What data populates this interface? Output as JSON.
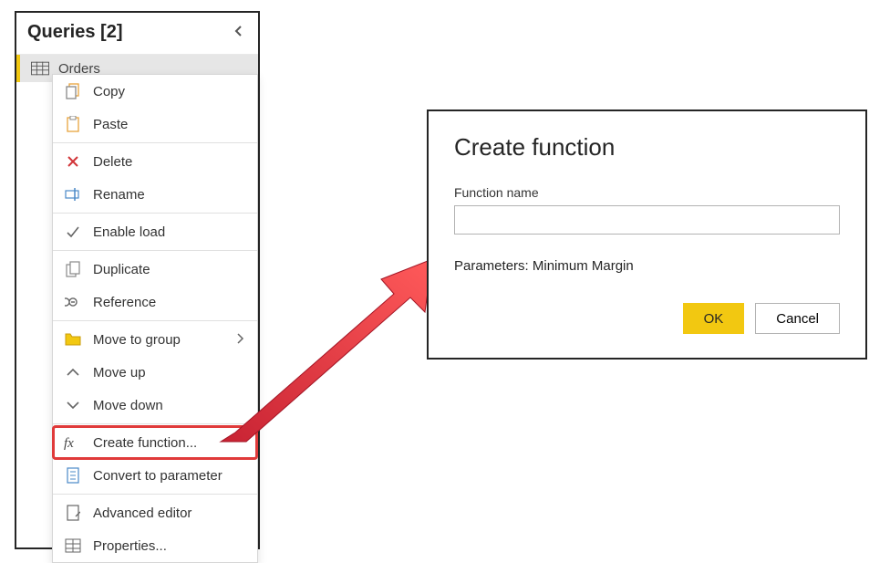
{
  "panel": {
    "title": "Queries [2]",
    "selected_query": "Orders"
  },
  "menu": {
    "copy": "Copy",
    "paste": "Paste",
    "delete": "Delete",
    "rename": "Rename",
    "enable_load": "Enable load",
    "duplicate": "Duplicate",
    "reference": "Reference",
    "move_to_group": "Move to group",
    "move_up": "Move up",
    "move_down": "Move down",
    "create_function": "Create function...",
    "convert_to_parameter": "Convert to parameter",
    "advanced_editor": "Advanced editor",
    "properties": "Properties..."
  },
  "dialog": {
    "title": "Create function",
    "field_label": "Function name",
    "field_value": "",
    "params_text": "Parameters: Minimum Margin",
    "ok": "OK",
    "cancel": "Cancel"
  }
}
